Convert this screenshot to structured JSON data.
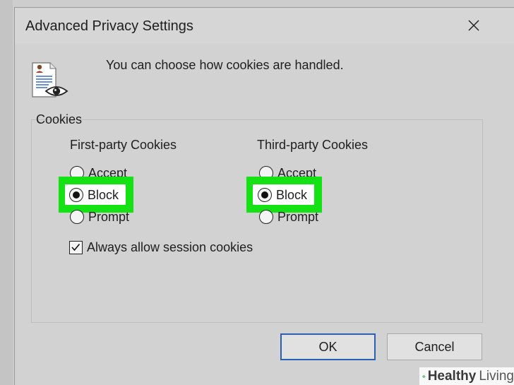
{
  "dialog": {
    "title": "Advanced Privacy Settings",
    "close_icon": "close-icon",
    "header_icon": "document-eye-icon",
    "intro": "You can choose how cookies are handled."
  },
  "cookies": {
    "group_label": "Cookies",
    "first_party": {
      "heading": "First-party Cookies",
      "options": [
        "Accept",
        "Block",
        "Prompt"
      ],
      "selected": "Block"
    },
    "third_party": {
      "heading": "Third-party Cookies",
      "options": [
        "Accept",
        "Block",
        "Prompt"
      ],
      "selected": "Block"
    },
    "session": {
      "label": "Always allow session cookies",
      "checked": true
    }
  },
  "buttons": {
    "ok": "OK",
    "cancel": "Cancel"
  },
  "watermark": {
    "brand_a": "Healthy",
    "brand_b": "Living",
    "icon": "cross-leaf-icon",
    "color": "#2fa84f"
  },
  "colors": {
    "highlight": "#14e214",
    "default_button_border": "#2b5fb4"
  }
}
